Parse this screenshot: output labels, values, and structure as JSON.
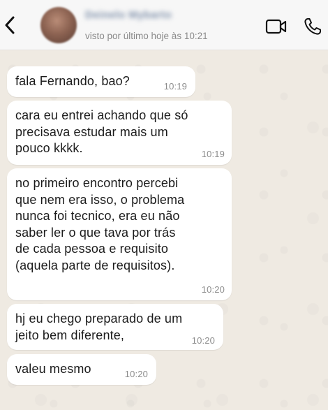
{
  "header": {
    "contact_name": "Deinelo Mybarto",
    "last_seen": "visto por último hoje às 10:21",
    "icons": {
      "back": "chevron-left-icon",
      "video": "video-camera-icon",
      "call": "phone-icon"
    }
  },
  "messages": [
    {
      "text": "fala Fernando, bao?",
      "time": "10:19"
    },
    {
      "text": "cara eu entrei achando que só\nprecisava estudar mais um\npouco kkkk.",
      "time": "10:19"
    },
    {
      "text": "no primeiro encontro percebi\nque nem era isso, o problema\nnunca foi tecnico, era eu não\nsaber ler o que tava por trás\nde cada pessoa e requisito\n(aquela parte de requisitos).",
      "time": "10:20"
    },
    {
      "text": "hj eu chego preparado de um\njeito bem diferente,",
      "time": "10:20"
    },
    {
      "text": "valeu mesmo",
      "time": "10:20"
    }
  ],
  "colors": {
    "chat_background": "#efeae2",
    "bubble": "#ffffff",
    "header": "#f7f7f7",
    "timestamp": "#8c8c8c"
  }
}
